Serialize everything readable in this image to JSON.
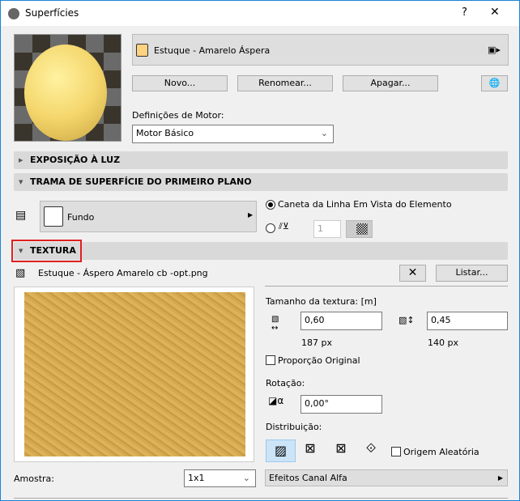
{
  "window": {
    "title": "Superfícies",
    "help": "?",
    "close": "✕"
  },
  "surface": {
    "name": "Estuque - Amarelo Áspera",
    "swatch_color": "#fdd281"
  },
  "buttons": {
    "new": "Novo...",
    "rename": "Renomear...",
    "delete": "Apagar..."
  },
  "engine": {
    "label": "Definições de Motor:",
    "value": "Motor Básico"
  },
  "sections": {
    "light": "EXPOSIÇÃO À LUZ",
    "fill": "TRAMA DE SUPERFÍCIE DO PRIMEIRO PLANO",
    "texture": "TEXTURA"
  },
  "fill": {
    "name": "Fundo",
    "radio1": "Caneta da Linha Em Vista do Elemento",
    "pen_value": "1"
  },
  "texture": {
    "file": "Estuque - Áspero Amarelo cb -opt.png",
    "list": "Listar...",
    "size_label": "Tamanho da textura: [m]",
    "width": "0,60",
    "height": "0,45",
    "width_px": "187 px",
    "height_px": "140 px",
    "proportion": "Proporção Original",
    "rotation_label": "Rotação:",
    "rotation": "0,00°",
    "distribution_label": "Distribuição:",
    "random_origin": "Origem Aleatória",
    "alpha": "Efeitos Canal Alfa"
  },
  "sample": {
    "label": "Amostra:",
    "value": "1x1"
  }
}
